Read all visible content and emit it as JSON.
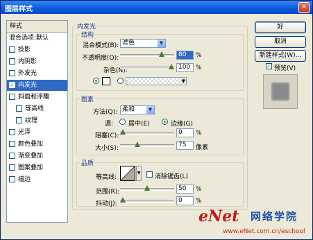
{
  "window": {
    "title": "图层样式",
    "close_glyph": "✕"
  },
  "sidebar": {
    "header": "样式",
    "items": [
      {
        "label": "混合选项:默认",
        "checkbox": false,
        "indent": 0
      },
      {
        "label": "投影",
        "checkbox": true,
        "checked": false,
        "indent": 0
      },
      {
        "label": "内阴影",
        "checkbox": true,
        "checked": false,
        "indent": 0
      },
      {
        "label": "外发光",
        "checkbox": true,
        "checked": false,
        "indent": 0
      },
      {
        "label": "内发光",
        "checkbox": true,
        "checked": true,
        "indent": 0,
        "selected": true
      },
      {
        "label": "斜面和浮雕",
        "checkbox": true,
        "checked": false,
        "indent": 0
      },
      {
        "label": "等高线",
        "checkbox": true,
        "checked": false,
        "indent": 1
      },
      {
        "label": "纹理",
        "checkbox": true,
        "checked": false,
        "indent": 1
      },
      {
        "label": "光泽",
        "checkbox": true,
        "checked": false,
        "indent": 0
      },
      {
        "label": "颜色叠加",
        "checkbox": true,
        "checked": false,
        "indent": 0
      },
      {
        "label": "渐变叠加",
        "checkbox": true,
        "checked": false,
        "indent": 0
      },
      {
        "label": "图案叠加",
        "checkbox": true,
        "checked": false,
        "indent": 0
      },
      {
        "label": "描边",
        "checkbox": true,
        "checked": false,
        "indent": 0
      }
    ]
  },
  "inner_glow": {
    "title": "内发光",
    "structure": {
      "title": "结构",
      "blend_mode_label": "混合模式(B):",
      "blend_mode_value": "滤色",
      "opacity_label": "不透明度(O):",
      "opacity_value": "80",
      "opacity_level": 0.8,
      "noise_label": "杂色(N):",
      "noise_value": "100",
      "noise_level": 1.0,
      "percent": "%"
    },
    "elements": {
      "title": "图素",
      "method_label": "方法(Q):",
      "method_value": "柔和",
      "source_label": "源:",
      "source_center": "居中(E)",
      "source_edge": "边缘(G)",
      "source_selected": "edge",
      "choke_label": "阻塞(C):",
      "choke_value": "0",
      "choke_level": 0.0,
      "size_label": "大小(S):",
      "size_value": "75",
      "size_level": 0.3,
      "size_unit": "像素",
      "percent": "%"
    },
    "quality": {
      "title": "品质",
      "contour_label": "等高线:",
      "antialias_label": "消除锯齿(L)",
      "antialias_checked": false,
      "range_label": "范围(R):",
      "range_value": "50",
      "range_level": 0.5,
      "jitter_label": "抖动(J):",
      "jitter_value": "0",
      "jitter_level": 0.0,
      "percent": "%"
    }
  },
  "buttons": {
    "ok": "好",
    "cancel": "取消",
    "new_style": "新建样式(W)...",
    "preview_label": "预览(V)",
    "preview_checked": true
  },
  "watermark": {
    "logo": "eNet",
    "cn": "网络学院",
    "url": "www.eNet.com.cn/eschool"
  },
  "colors": {
    "accent": "#316ac5",
    "title_bar": "#0a5ce0",
    "check_green": "#21a121",
    "watermark_red": "#c01818",
    "watermark_blue": "#1a50a6"
  }
}
